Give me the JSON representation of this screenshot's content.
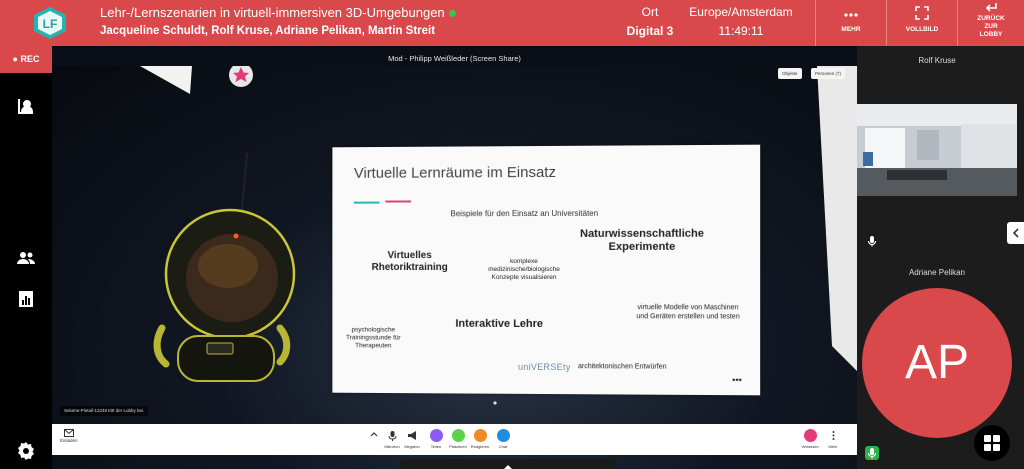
{
  "header": {
    "logo_text": "LF",
    "title": "Lehr-/Lernszenarien in virtuell-immersiven 3D-Umgebungen",
    "presenters": "Jacqueline Schuldt, Rolf Kruse, Adriane Pelikan, Martin Streit",
    "location_label": "Ort",
    "location_value": "Digital 3",
    "timezone_label": "Europe/Amsterdam",
    "time_value": "11:49:11",
    "more_label": "MEHR",
    "fullscreen_label": "VOLLBILD",
    "back_label_1": "ZURÜCK",
    "back_label_2": "ZUR",
    "back_label_3": "LOBBY",
    "accent_color": "#d9494c"
  },
  "leftbar": {
    "rec_label": "REC",
    "icons": [
      "contact-card-icon",
      "people-icon",
      "report-icon",
      "settings-icon"
    ]
  },
  "stage": {
    "title": "Mod - Philipp Weißleder (Screen Share)",
    "panel_chips": [
      "Objekte",
      "Personen (7)"
    ],
    "lobby_note": "Selume-Pintail-12248 tritt der Lobby bei."
  },
  "slide": {
    "title": "Virtuelle Lernräume im Einsatz",
    "subtitle": "Beispiele für den Einsatz an Universitäten",
    "kw_rhetorik_1": "Virtuelles",
    "kw_rhetorik_2": "Rhetoriktraining",
    "kw_natur_1": "Naturwissenschaftliche",
    "kw_natur_2": "Experimente",
    "kw_interaktiv": "Interaktive Lehre",
    "sm_komplex_1": "komplexe",
    "sm_komplex_2": "medizinische/biologische",
    "sm_komplex_3": "Konzepte visualisieren",
    "sm_modelle_1": "virtuelle Modelle von Maschinen",
    "sm_modelle_2": "und Geräten erstellen und testen",
    "sm_psych_1": "psychologische",
    "sm_psych_2": "Trainingsstunde für",
    "sm_psych_3": "Therapeuten",
    "brand": "uniVERSEty",
    "sm_archi": "architektonischen Entwürfen",
    "more": "•••"
  },
  "bottombar": {
    "left_label": "Einladen",
    "buttons": [
      {
        "label": "Mikrofon",
        "color": "#ffffff"
      },
      {
        "label": "Megafon",
        "color": "#ffffff"
      },
      {
        "label": "Teilen",
        "color": "#8a5cf5"
      },
      {
        "label": "Platzieren",
        "color": "#5bd24a"
      },
      {
        "label": "Reagieren",
        "color": "#f08a24"
      },
      {
        "label": "Chat",
        "color": "#1e8fe0"
      }
    ],
    "leave_label": "Verlassen",
    "leave_color": "#e23b7a",
    "more_label": "Mehr"
  },
  "participants": [
    {
      "name": "Rolf Kruse",
      "mic": "muted"
    },
    {
      "name": "Adriane Pelikan",
      "initials": "AP",
      "mic": "active"
    }
  ]
}
